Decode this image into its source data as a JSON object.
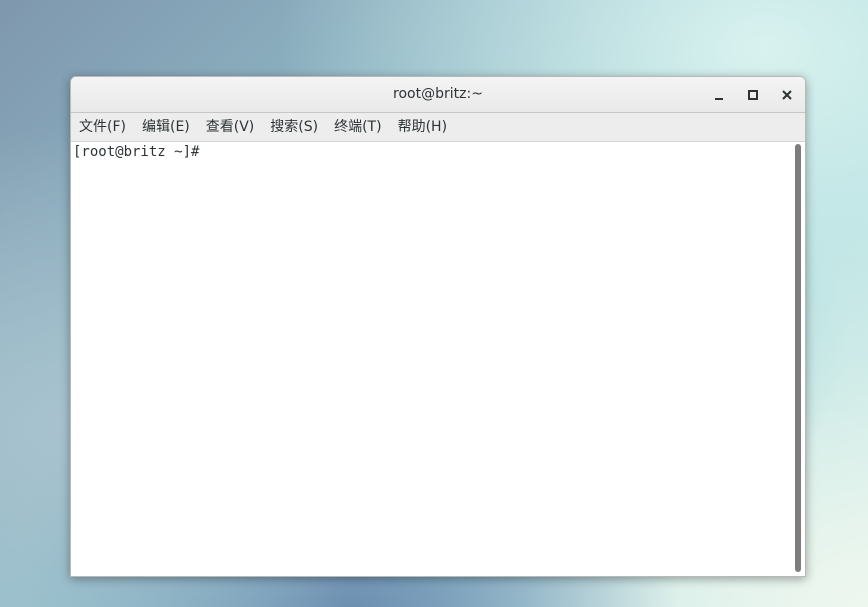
{
  "window": {
    "title": "root@britz:~",
    "controls": {
      "minimize_icon": "minimize-icon",
      "maximize_icon": "maximize-icon",
      "close_icon": "close-icon",
      "close_glyph": "✕"
    }
  },
  "menubar": {
    "items": [
      {
        "label": "文件(F)"
      },
      {
        "label": "编辑(E)"
      },
      {
        "label": "查看(V)"
      },
      {
        "label": "搜索(S)"
      },
      {
        "label": "终端(T)"
      },
      {
        "label": "帮助(H)"
      }
    ]
  },
  "terminal": {
    "prompt": "[root@britz ~]# "
  },
  "colors": {
    "titlebar": "#e9e9e9",
    "menubar": "#ededed",
    "terminal_bg": "#ffffff",
    "text": "#2e3436",
    "scroll_thumb": "#7d7d7d"
  }
}
